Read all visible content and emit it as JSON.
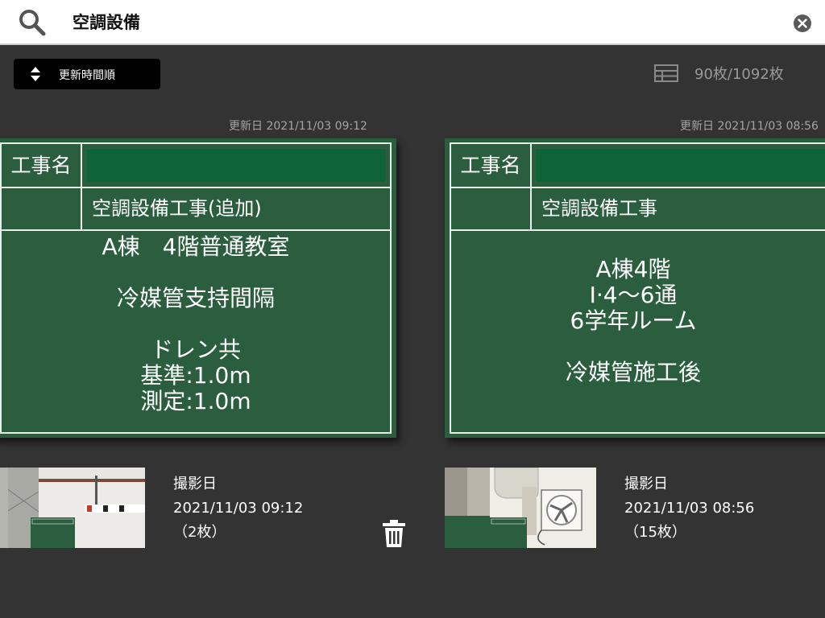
{
  "search": {
    "query": "空調設備",
    "placeholder": ""
  },
  "toolbar": {
    "sort_label": "更新時間順",
    "count_label": "90枚/1092枚"
  },
  "cards": [
    {
      "updated": "更新日 2021/11/03 09:12",
      "board": {
        "label": "工事名",
        "subject": "空調設備工事(追加)",
        "notes": [
          "A棟　4階普通教室",
          "",
          "冷媒管支持間隔",
          "",
          "ドレン共",
          "基準:1.0m",
          "測定:1.0m"
        ]
      },
      "shot_label": "撮影日",
      "shot_date": "2021/11/03 09:12",
      "shot_count": "（2枚）"
    },
    {
      "updated": "更新日 2021/11/03 08:56",
      "board": {
        "label": "工事名",
        "subject": "空調設備工事",
        "notes": [
          "A棟4階",
          "Ⅰ·4〜6通",
          "6学年ルーム",
          "",
          "冷媒管施工後"
        ]
      },
      "shot_label": "撮影日",
      "shot_date": "2021/11/03 08:56",
      "shot_count": "（15枚）"
    }
  ],
  "icons": {
    "search": "search-icon",
    "clear": "close-circle-icon",
    "sort": "sort-arrows-icon",
    "grid": "grid-view-icon",
    "trash": "trash-icon"
  },
  "colors": {
    "background": "#333333",
    "board": "#2a5e3f",
    "board_name_fill": "#0e6438"
  }
}
